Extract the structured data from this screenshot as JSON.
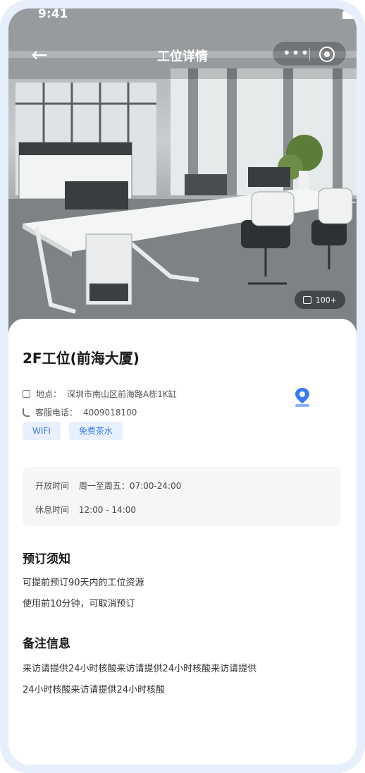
{
  "status_bar": {
    "time": "9:41"
  },
  "nav": {
    "title": "工位详情",
    "more_icon": "more-dots-icon",
    "target_icon": "target-icon"
  },
  "hero": {
    "photo_count": "100+"
  },
  "place": {
    "name": "2F工位(前海大厦)",
    "address_label": "地点：",
    "address": "深圳市南山区前海路A栋1K缸",
    "phone_label": "客服电话：",
    "phone": "4009018100",
    "tags": [
      "WIFI",
      "免费茶水"
    ]
  },
  "hours": {
    "open_label": "开放时间",
    "open_value": "周一至周五：07:00-24:00",
    "rest_label": "休息时间",
    "rest_value": "12:00 - 14:00"
  },
  "notice": {
    "title": "预订须知",
    "lines": [
      "可提前预订90天内的工位资源",
      "使用前10分钟，可取消预订"
    ]
  },
  "remark": {
    "title": "备注信息",
    "lines": [
      "来访请提供24小时核酸来访请提供24小时核酸来访请提供",
      "24小时核酸来访请提供24小时核酸"
    ]
  },
  "colors": {
    "accent": "#3a7bea",
    "tag_bg": "#e8f0fd",
    "frame": "#e6effb"
  }
}
